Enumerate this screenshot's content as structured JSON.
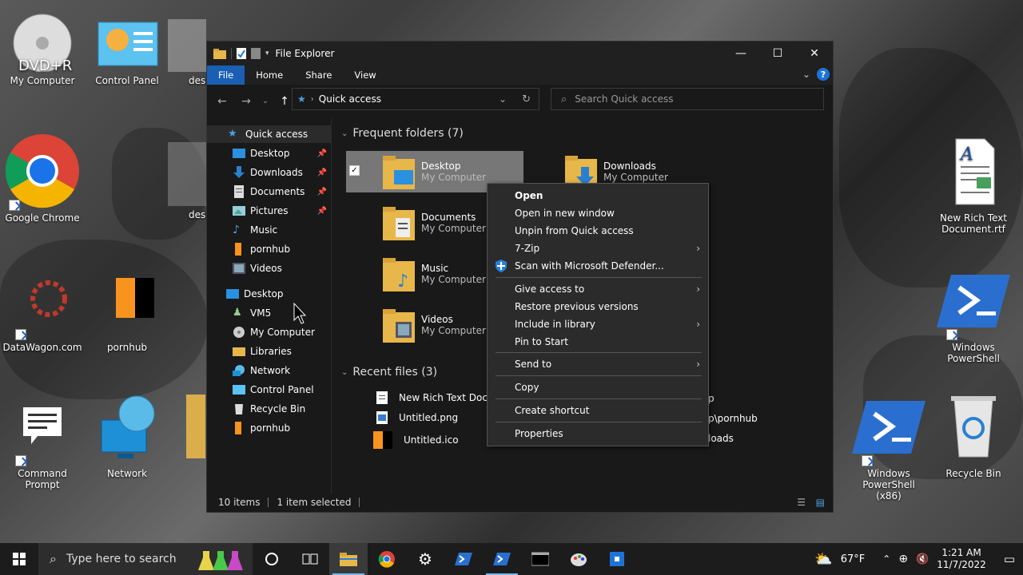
{
  "desktop": {
    "icons": {
      "dvd": {
        "badge": "DVD+R",
        "label": "My Computer"
      },
      "control_panel": "Control Panel",
      "chrome": "Google Chrome",
      "datawagon": "DataWagon.com",
      "pornhub": "pornhub",
      "command_prompt": "Command Prompt",
      "network": "Network",
      "rtf": "New Rich Text Document.rtf",
      "powershell": "Windows PowerShell",
      "powershell86": "Windows PowerShell (x86)",
      "recycle": "Recycle Bin",
      "desk_partial_1": "desk",
      "desk_partial_2": "desk"
    }
  },
  "window": {
    "title": "File Explorer",
    "ribbon": {
      "tabs": [
        "File",
        "Home",
        "Share",
        "View"
      ]
    },
    "address": "Quick access",
    "search_placeholder": "Search Quick access",
    "nav": {
      "quick_access": "Quick access",
      "pinned": [
        "Desktop",
        "Downloads",
        "Documents",
        "Pictures"
      ],
      "unpinned": [
        "Music",
        "pornhub",
        "Videos"
      ],
      "tree_root": "Desktop",
      "tree": [
        "VM5",
        "My Computer",
        "Libraries",
        "Network",
        "Control Panel",
        "Recycle Bin",
        "pornhub"
      ]
    },
    "frequent": {
      "header": "Frequent folders (7)",
      "items": [
        {
          "name": "Desktop",
          "loc": "My Computer"
        },
        {
          "name": "Downloads",
          "loc": "My Computer"
        },
        {
          "name": "Documents",
          "loc": "My Computer"
        },
        {
          "name": "Music",
          "loc": "My Computer"
        },
        {
          "name": "Videos",
          "loc": "My Computer"
        }
      ]
    },
    "recent": {
      "header": "Recent files (3)",
      "items": [
        {
          "name": "New Rich Text Docur",
          "loc": "p"
        },
        {
          "name": "Untitled.png",
          "loc": "p\\pornhub"
        },
        {
          "name": "Untitled.ico",
          "loc": "loads"
        }
      ]
    },
    "status": {
      "count": "10 items",
      "selected": "1 item selected"
    }
  },
  "context_menu": {
    "open": "Open",
    "open_new": "Open in new window",
    "unpin": "Unpin from Quick access",
    "zip": "7-Zip",
    "defender": "Scan with Microsoft Defender...",
    "give_access": "Give access to",
    "restore": "Restore previous versions",
    "library": "Include in library",
    "pin_start": "Pin to Start",
    "send_to": "Send to",
    "copy": "Copy",
    "shortcut": "Create shortcut",
    "properties": "Properties"
  },
  "taskbar": {
    "search_placeholder": "Type here to search",
    "weather": "67°F",
    "time": "1:21 AM",
    "date": "11/7/2022"
  },
  "colors": {
    "accent": "#1a5fb4",
    "folder": "#e8b74a",
    "chrome_blue": "#1a73e8"
  }
}
